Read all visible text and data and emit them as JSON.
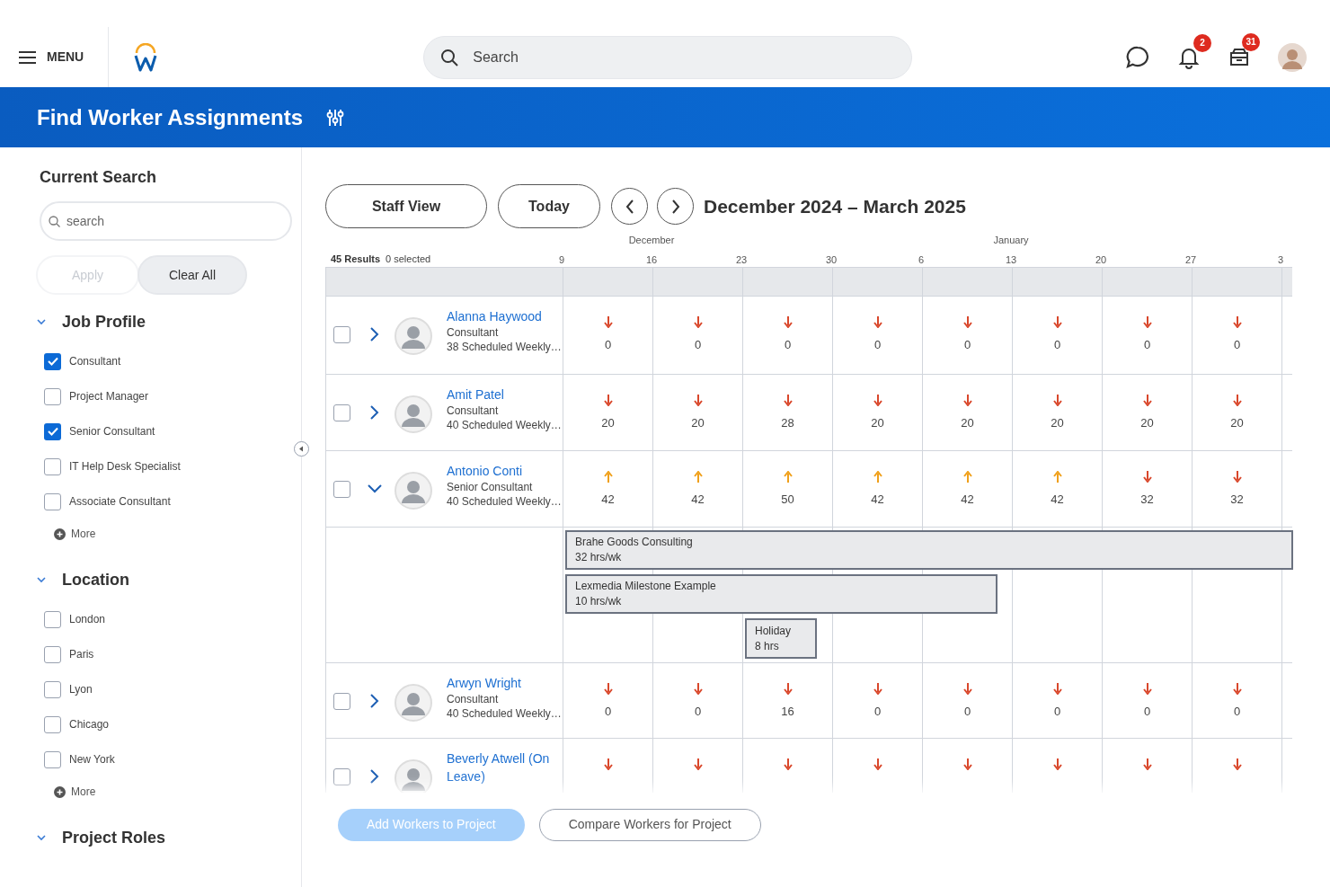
{
  "top_bar": {
    "menu_label": "MENU",
    "search_placeholder": "Search",
    "notification_badge": "2",
    "inbox_badge": "31"
  },
  "banner": {
    "title": "Find Worker Assignments"
  },
  "sidebar": {
    "title": "Current Search",
    "search_placeholder": "search",
    "buttons": [
      {
        "label": "Apply",
        "disabled": true
      },
      {
        "label": "Clear All",
        "disabled": false
      }
    ],
    "sections": [
      {
        "title": "Job Profile",
        "expanded": true,
        "more": "More",
        "options": [
          {
            "label": "Consultant",
            "checked": true
          },
          {
            "label": "Project Manager",
            "checked": false
          },
          {
            "label": "Senior Consultant",
            "checked": true
          },
          {
            "label": "IT Help Desk Specialist",
            "checked": false
          },
          {
            "label": "Associate Consultant",
            "checked": false
          }
        ]
      },
      {
        "title": "Location",
        "expanded": true,
        "more": "More",
        "options": [
          {
            "label": "London",
            "checked": false
          },
          {
            "label": "Paris",
            "checked": false
          },
          {
            "label": "Lyon",
            "checked": false
          },
          {
            "label": "Chicago",
            "checked": false
          },
          {
            "label": "New York",
            "checked": false
          }
        ]
      },
      {
        "title": "Project Roles",
        "expanded": true
      }
    ]
  },
  "toolbar": {
    "buttons": [
      "Staff View",
      "Today"
    ],
    "period": "December 2024 – March 2025"
  },
  "timeline": {
    "results": "45 Results",
    "selected_count": "0 selected",
    "weeks": [
      {
        "label": "9"
      },
      {
        "label": "16",
        "month": "December"
      },
      {
        "label": "23"
      },
      {
        "label": "30"
      },
      {
        "label": "6"
      },
      {
        "label": "13",
        "month": "January"
      },
      {
        "label": "20"
      },
      {
        "label": "27"
      },
      {
        "label": "3"
      }
    ],
    "workers": [
      {
        "name": "Alanna Haywood",
        "role": "Consultant",
        "schedule": "38 Scheduled Weekly…",
        "selected": false,
        "expanded": false,
        "cells": [
          {
            "over": false,
            "value": "0"
          },
          {
            "over": false,
            "value": "0"
          },
          {
            "over": false,
            "value": "0"
          },
          {
            "over": false,
            "value": "0"
          },
          {
            "over": false,
            "value": "0"
          },
          {
            "over": false,
            "value": "0"
          },
          {
            "over": false,
            "value": "0"
          },
          {
            "over": false,
            "value": "0"
          }
        ]
      },
      {
        "name": "Amit Patel",
        "role": "Consultant",
        "schedule": "40 Scheduled Weekly…",
        "selected": false,
        "expanded": false,
        "cells": [
          {
            "over": false,
            "value": "20"
          },
          {
            "over": false,
            "value": "20"
          },
          {
            "over": false,
            "value": "28"
          },
          {
            "over": false,
            "value": "20"
          },
          {
            "over": false,
            "value": "20"
          },
          {
            "over": false,
            "value": "20"
          },
          {
            "over": false,
            "value": "20"
          },
          {
            "over": false,
            "value": "20"
          }
        ]
      },
      {
        "name": "Antonio Conti",
        "role": "Senior Consultant",
        "schedule": "40 Scheduled Weekly…",
        "selected": false,
        "expanded": true,
        "cells": [
          {
            "over": true,
            "value": "42"
          },
          {
            "over": true,
            "value": "42"
          },
          {
            "over": true,
            "value": "50"
          },
          {
            "over": true,
            "value": "42"
          },
          {
            "over": true,
            "value": "42"
          },
          {
            "over": true,
            "value": "42"
          },
          {
            "over": false,
            "value": "32"
          },
          {
            "over": false,
            "value": "32"
          }
        ],
        "assignments": [
          {
            "name": "Brahe Goods Consulting",
            "hours": "32 hrs/wk"
          },
          {
            "name": "Lexmedia Milestone Example",
            "hours": "10 hrs/wk"
          },
          {
            "name": "Holiday",
            "hours": "8 hrs"
          }
        ]
      },
      {
        "name": "Arwyn Wright",
        "role": "Consultant",
        "schedule": "40 Scheduled Weekly…",
        "selected": false,
        "expanded": false,
        "cells": [
          {
            "over": false,
            "value": "0"
          },
          {
            "over": false,
            "value": "0"
          },
          {
            "over": false,
            "value": "16"
          },
          {
            "over": false,
            "value": "0"
          },
          {
            "over": false,
            "value": "0"
          },
          {
            "over": false,
            "value": "0"
          },
          {
            "over": false,
            "value": "0"
          },
          {
            "over": false,
            "value": "0"
          }
        ]
      },
      {
        "name": "Beverly Atwell (On Leave)",
        "selected": false,
        "expanded": false,
        "cells": [
          {
            "over": false
          },
          {
            "over": false
          },
          {
            "over": false
          },
          {
            "over": false
          },
          {
            "over": false
          },
          {
            "over": false
          },
          {
            "over": false
          },
          {
            "over": false
          }
        ]
      }
    ]
  },
  "actions": [
    {
      "label": "Add Workers to Project",
      "kind": "primary",
      "disabled": true
    },
    {
      "label": "Compare Workers for Project",
      "kind": "secondary",
      "disabled": false
    }
  ]
}
